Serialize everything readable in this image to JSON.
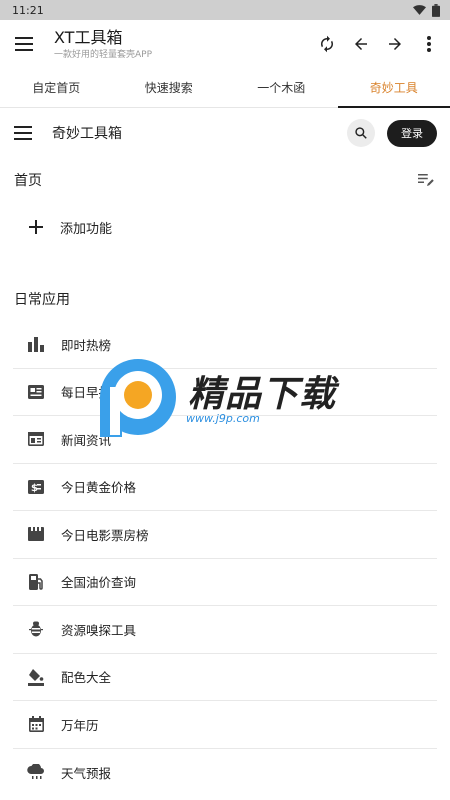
{
  "status_bar": {
    "time": "11:21"
  },
  "app_bar": {
    "title": "XT工具箱",
    "subtitle": "一款好用的轻量套壳APP"
  },
  "tabs": [
    {
      "label": "自定首页",
      "active": false
    },
    {
      "label": "快速搜索",
      "active": false
    },
    {
      "label": "一个木函",
      "active": false
    },
    {
      "label": "奇妙工具",
      "active": true
    }
  ],
  "toolbar": {
    "title": "奇妙工具箱",
    "login_label": "登录"
  },
  "home_section": {
    "title": "首页",
    "add_label": "添加功能"
  },
  "daily_section": {
    "title": "日常应用",
    "items": [
      {
        "label": "即时热榜",
        "icon": "bar-chart-icon"
      },
      {
        "label": "每日早报",
        "icon": "newspaper-card-icon"
      },
      {
        "label": "新闻资讯",
        "icon": "news-layout-icon"
      },
      {
        "label": "今日黄金价格",
        "icon": "money-icon"
      },
      {
        "label": "今日电影票房榜",
        "icon": "movie-clapper-icon"
      },
      {
        "label": "全国油价查询",
        "icon": "gas-station-icon"
      },
      {
        "label": "资源嗅探工具",
        "icon": "bug-icon"
      },
      {
        "label": "配色大全",
        "icon": "paint-bucket-icon"
      },
      {
        "label": "万年历",
        "icon": "calendar-icon"
      },
      {
        "label": "天气预报",
        "icon": "weather-cloud-icon"
      }
    ]
  },
  "watermark": {
    "brand": "精品下载",
    "url": "www.j9p.com"
  },
  "colors": {
    "accent": "#d9822b",
    "login_bg": "#1d1d1d",
    "statusbar_bg": "#cfcfcf"
  }
}
